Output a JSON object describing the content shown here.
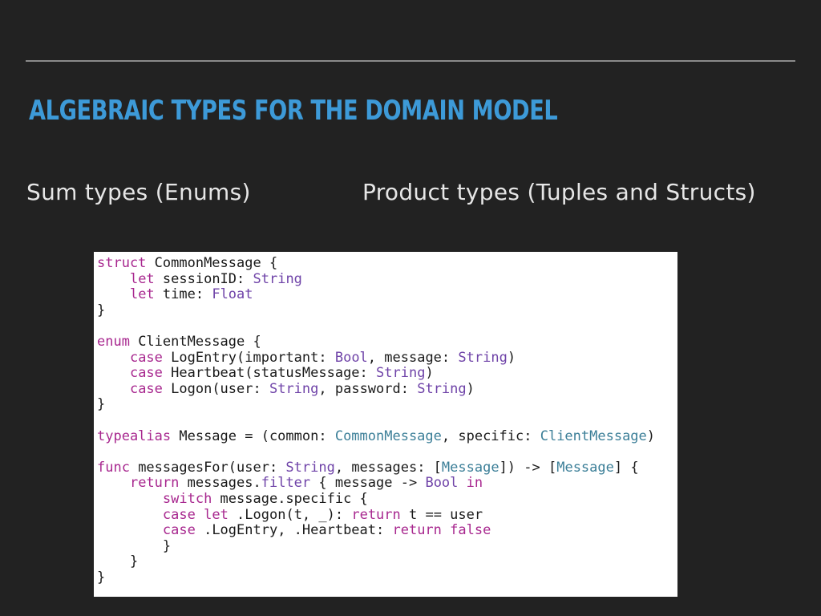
{
  "slide": {
    "title": "ALGEBRAIC TYPES FOR THE DOMAIN MODEL",
    "left_heading": "Sum types (Enums)",
    "right_heading": "Product types (Tuples and Structs)"
  },
  "colors": {
    "background": "#222222",
    "title": "#3d9ad8",
    "text": "#e6e6e6",
    "keyword": "#a8288f",
    "type": "#6f43a8",
    "class": "#3c7f98"
  },
  "code": {
    "lines": [
      [
        {
          "t": "struct",
          "c": "kw"
        },
        {
          "t": " CommonMessage {",
          "c": "pl"
        }
      ],
      [
        {
          "t": "    ",
          "c": "pl"
        },
        {
          "t": "let",
          "c": "kw"
        },
        {
          "t": " sessionID: ",
          "c": "pl"
        },
        {
          "t": "String",
          "c": "ty"
        }
      ],
      [
        {
          "t": "    ",
          "c": "pl"
        },
        {
          "t": "let",
          "c": "kw"
        },
        {
          "t": " time: ",
          "c": "pl"
        },
        {
          "t": "Float",
          "c": "ty"
        }
      ],
      [
        {
          "t": "}",
          "c": "pl"
        }
      ],
      [
        {
          "t": "",
          "c": "pl"
        }
      ],
      [
        {
          "t": "enum",
          "c": "kw"
        },
        {
          "t": " ClientMessage {",
          "c": "pl"
        }
      ],
      [
        {
          "t": "    ",
          "c": "pl"
        },
        {
          "t": "case",
          "c": "kw"
        },
        {
          "t": " LogEntry(important: ",
          "c": "pl"
        },
        {
          "t": "Bool",
          "c": "ty"
        },
        {
          "t": ", message: ",
          "c": "pl"
        },
        {
          "t": "String",
          "c": "ty"
        },
        {
          "t": ")",
          "c": "pl"
        }
      ],
      [
        {
          "t": "    ",
          "c": "pl"
        },
        {
          "t": "case",
          "c": "kw"
        },
        {
          "t": " Heartbeat(statusMessage: ",
          "c": "pl"
        },
        {
          "t": "String",
          "c": "ty"
        },
        {
          "t": ")",
          "c": "pl"
        }
      ],
      [
        {
          "t": "    ",
          "c": "pl"
        },
        {
          "t": "case",
          "c": "kw"
        },
        {
          "t": " Logon(user: ",
          "c": "pl"
        },
        {
          "t": "String",
          "c": "ty"
        },
        {
          "t": ", password: ",
          "c": "pl"
        },
        {
          "t": "String",
          "c": "ty"
        },
        {
          "t": ")",
          "c": "pl"
        }
      ],
      [
        {
          "t": "}",
          "c": "pl"
        }
      ],
      [
        {
          "t": "",
          "c": "pl"
        }
      ],
      [
        {
          "t": "typealias",
          "c": "kw"
        },
        {
          "t": " Message = (common: ",
          "c": "pl"
        },
        {
          "t": "CommonMessage",
          "c": "cls"
        },
        {
          "t": ", specific: ",
          "c": "pl"
        },
        {
          "t": "ClientMessage",
          "c": "cls"
        },
        {
          "t": ")",
          "c": "pl"
        }
      ],
      [
        {
          "t": "",
          "c": "pl"
        }
      ],
      [
        {
          "t": "func",
          "c": "kw"
        },
        {
          "t": " messagesFor(user: ",
          "c": "pl"
        },
        {
          "t": "String",
          "c": "ty"
        },
        {
          "t": ", messages: [",
          "c": "pl"
        },
        {
          "t": "Message",
          "c": "cls"
        },
        {
          "t": "]) -> [",
          "c": "pl"
        },
        {
          "t": "Message",
          "c": "cls"
        },
        {
          "t": "] {",
          "c": "pl"
        }
      ],
      [
        {
          "t": "    ",
          "c": "pl"
        },
        {
          "t": "return",
          "c": "kw"
        },
        {
          "t": " messages.",
          "c": "pl"
        },
        {
          "t": "filter",
          "c": "ty"
        },
        {
          "t": " { message -> ",
          "c": "pl"
        },
        {
          "t": "Bool",
          "c": "ty"
        },
        {
          "t": " ",
          "c": "pl"
        },
        {
          "t": "in",
          "c": "kw"
        }
      ],
      [
        {
          "t": "        ",
          "c": "pl"
        },
        {
          "t": "switch",
          "c": "kw"
        },
        {
          "t": " message.specific {",
          "c": "pl"
        }
      ],
      [
        {
          "t": "        ",
          "c": "pl"
        },
        {
          "t": "case",
          "c": "kw"
        },
        {
          "t": " ",
          "c": "pl"
        },
        {
          "t": "let",
          "c": "kw"
        },
        {
          "t": " .Logon(t, _): ",
          "c": "pl"
        },
        {
          "t": "return",
          "c": "kw"
        },
        {
          "t": " t == user",
          "c": "pl"
        }
      ],
      [
        {
          "t": "        ",
          "c": "pl"
        },
        {
          "t": "case",
          "c": "kw"
        },
        {
          "t": " .LogEntry, .Heartbeat: ",
          "c": "pl"
        },
        {
          "t": "return",
          "c": "kw"
        },
        {
          "t": " ",
          "c": "pl"
        },
        {
          "t": "false",
          "c": "kw"
        }
      ],
      [
        {
          "t": "        }",
          "c": "pl"
        }
      ],
      [
        {
          "t": "    }",
          "c": "pl"
        }
      ],
      [
        {
          "t": "}",
          "c": "pl"
        }
      ]
    ]
  }
}
